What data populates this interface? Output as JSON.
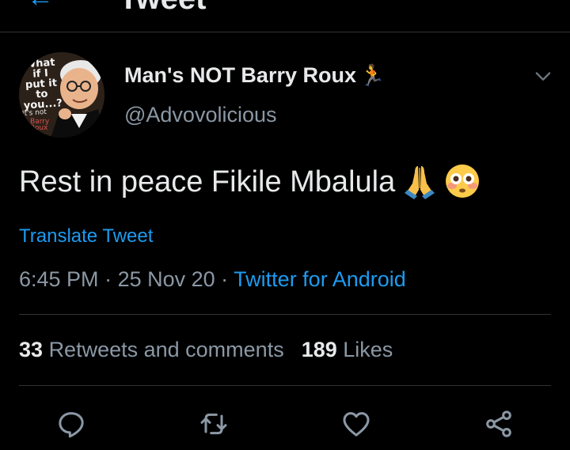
{
  "header": {
    "title": "Tweet",
    "back_icon": "back-arrow-icon"
  },
  "author": {
    "display_name": "Man's NOT Barry Roux",
    "name_emoji": "🏃",
    "handle": "@Advovolicious",
    "avatar": {
      "caption": "What if I put it to you...?",
      "small_text": "It's not",
      "red_text": "Barry Roux"
    }
  },
  "tweet": {
    "text": "Rest in peace Fikile Mbalula",
    "emojis": [
      "pray-icon",
      "flushed-face-icon"
    ],
    "translate_label": "Translate Tweet",
    "time": "6:45 PM",
    "separator": " · ",
    "date": "25 Nov 20",
    "source": "Twitter for Android"
  },
  "stats": {
    "retweets_count": "33",
    "retweets_label": "Retweets and comments",
    "likes_count": "189",
    "likes_label": "Likes"
  },
  "actions": [
    {
      "name": "reply",
      "icon": "reply-icon"
    },
    {
      "name": "retweet",
      "icon": "retweet-icon"
    },
    {
      "name": "like",
      "icon": "heart-icon"
    },
    {
      "name": "share",
      "icon": "share-icon"
    }
  ],
  "colors": {
    "background": "#000000",
    "text": "#e7e9ea",
    "secondary": "#8b98a5",
    "accent": "#1d9bf0",
    "divider": "#2f3336"
  }
}
